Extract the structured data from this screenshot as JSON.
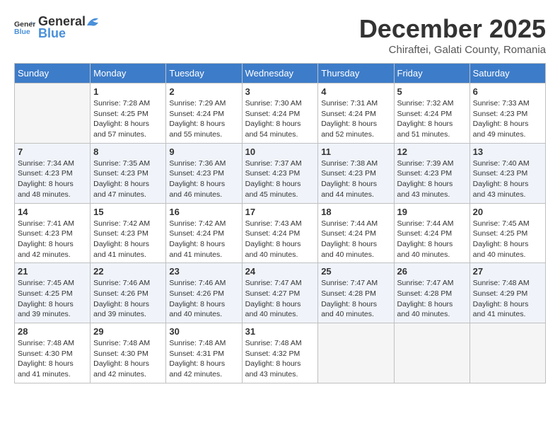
{
  "logo": {
    "general": "General",
    "blue": "Blue"
  },
  "title": "December 2025",
  "subtitle": "Chiraftei, Galati County, Romania",
  "days_header": [
    "Sunday",
    "Monday",
    "Tuesday",
    "Wednesday",
    "Thursday",
    "Friday",
    "Saturday"
  ],
  "weeks": [
    [
      {
        "day": "",
        "info": ""
      },
      {
        "day": "1",
        "info": "Sunrise: 7:28 AM\nSunset: 4:25 PM\nDaylight: 8 hours\nand 57 minutes."
      },
      {
        "day": "2",
        "info": "Sunrise: 7:29 AM\nSunset: 4:24 PM\nDaylight: 8 hours\nand 55 minutes."
      },
      {
        "day": "3",
        "info": "Sunrise: 7:30 AM\nSunset: 4:24 PM\nDaylight: 8 hours\nand 54 minutes."
      },
      {
        "day": "4",
        "info": "Sunrise: 7:31 AM\nSunset: 4:24 PM\nDaylight: 8 hours\nand 52 minutes."
      },
      {
        "day": "5",
        "info": "Sunrise: 7:32 AM\nSunset: 4:24 PM\nDaylight: 8 hours\nand 51 minutes."
      },
      {
        "day": "6",
        "info": "Sunrise: 7:33 AM\nSunset: 4:23 PM\nDaylight: 8 hours\nand 49 minutes."
      }
    ],
    [
      {
        "day": "7",
        "info": "Sunrise: 7:34 AM\nSunset: 4:23 PM\nDaylight: 8 hours\nand 48 minutes."
      },
      {
        "day": "8",
        "info": "Sunrise: 7:35 AM\nSunset: 4:23 PM\nDaylight: 8 hours\nand 47 minutes."
      },
      {
        "day": "9",
        "info": "Sunrise: 7:36 AM\nSunset: 4:23 PM\nDaylight: 8 hours\nand 46 minutes."
      },
      {
        "day": "10",
        "info": "Sunrise: 7:37 AM\nSunset: 4:23 PM\nDaylight: 8 hours\nand 45 minutes."
      },
      {
        "day": "11",
        "info": "Sunrise: 7:38 AM\nSunset: 4:23 PM\nDaylight: 8 hours\nand 44 minutes."
      },
      {
        "day": "12",
        "info": "Sunrise: 7:39 AM\nSunset: 4:23 PM\nDaylight: 8 hours\nand 43 minutes."
      },
      {
        "day": "13",
        "info": "Sunrise: 7:40 AM\nSunset: 4:23 PM\nDaylight: 8 hours\nand 43 minutes."
      }
    ],
    [
      {
        "day": "14",
        "info": "Sunrise: 7:41 AM\nSunset: 4:23 PM\nDaylight: 8 hours\nand 42 minutes."
      },
      {
        "day": "15",
        "info": "Sunrise: 7:42 AM\nSunset: 4:23 PM\nDaylight: 8 hours\nand 41 minutes."
      },
      {
        "day": "16",
        "info": "Sunrise: 7:42 AM\nSunset: 4:24 PM\nDaylight: 8 hours\nand 41 minutes."
      },
      {
        "day": "17",
        "info": "Sunrise: 7:43 AM\nSunset: 4:24 PM\nDaylight: 8 hours\nand 40 minutes."
      },
      {
        "day": "18",
        "info": "Sunrise: 7:44 AM\nSunset: 4:24 PM\nDaylight: 8 hours\nand 40 minutes."
      },
      {
        "day": "19",
        "info": "Sunrise: 7:44 AM\nSunset: 4:24 PM\nDaylight: 8 hours\nand 40 minutes."
      },
      {
        "day": "20",
        "info": "Sunrise: 7:45 AM\nSunset: 4:25 PM\nDaylight: 8 hours\nand 40 minutes."
      }
    ],
    [
      {
        "day": "21",
        "info": "Sunrise: 7:45 AM\nSunset: 4:25 PM\nDaylight: 8 hours\nand 39 minutes."
      },
      {
        "day": "22",
        "info": "Sunrise: 7:46 AM\nSunset: 4:26 PM\nDaylight: 8 hours\nand 39 minutes."
      },
      {
        "day": "23",
        "info": "Sunrise: 7:46 AM\nSunset: 4:26 PM\nDaylight: 8 hours\nand 40 minutes."
      },
      {
        "day": "24",
        "info": "Sunrise: 7:47 AM\nSunset: 4:27 PM\nDaylight: 8 hours\nand 40 minutes."
      },
      {
        "day": "25",
        "info": "Sunrise: 7:47 AM\nSunset: 4:28 PM\nDaylight: 8 hours\nand 40 minutes."
      },
      {
        "day": "26",
        "info": "Sunrise: 7:47 AM\nSunset: 4:28 PM\nDaylight: 8 hours\nand 40 minutes."
      },
      {
        "day": "27",
        "info": "Sunrise: 7:48 AM\nSunset: 4:29 PM\nDaylight: 8 hours\nand 41 minutes."
      }
    ],
    [
      {
        "day": "28",
        "info": "Sunrise: 7:48 AM\nSunset: 4:30 PM\nDaylight: 8 hours\nand 41 minutes."
      },
      {
        "day": "29",
        "info": "Sunrise: 7:48 AM\nSunset: 4:30 PM\nDaylight: 8 hours\nand 42 minutes."
      },
      {
        "day": "30",
        "info": "Sunrise: 7:48 AM\nSunset: 4:31 PM\nDaylight: 8 hours\nand 42 minutes."
      },
      {
        "day": "31",
        "info": "Sunrise: 7:48 AM\nSunset: 4:32 PM\nDaylight: 8 hours\nand 43 minutes."
      },
      {
        "day": "",
        "info": ""
      },
      {
        "day": "",
        "info": ""
      },
      {
        "day": "",
        "info": ""
      }
    ]
  ]
}
